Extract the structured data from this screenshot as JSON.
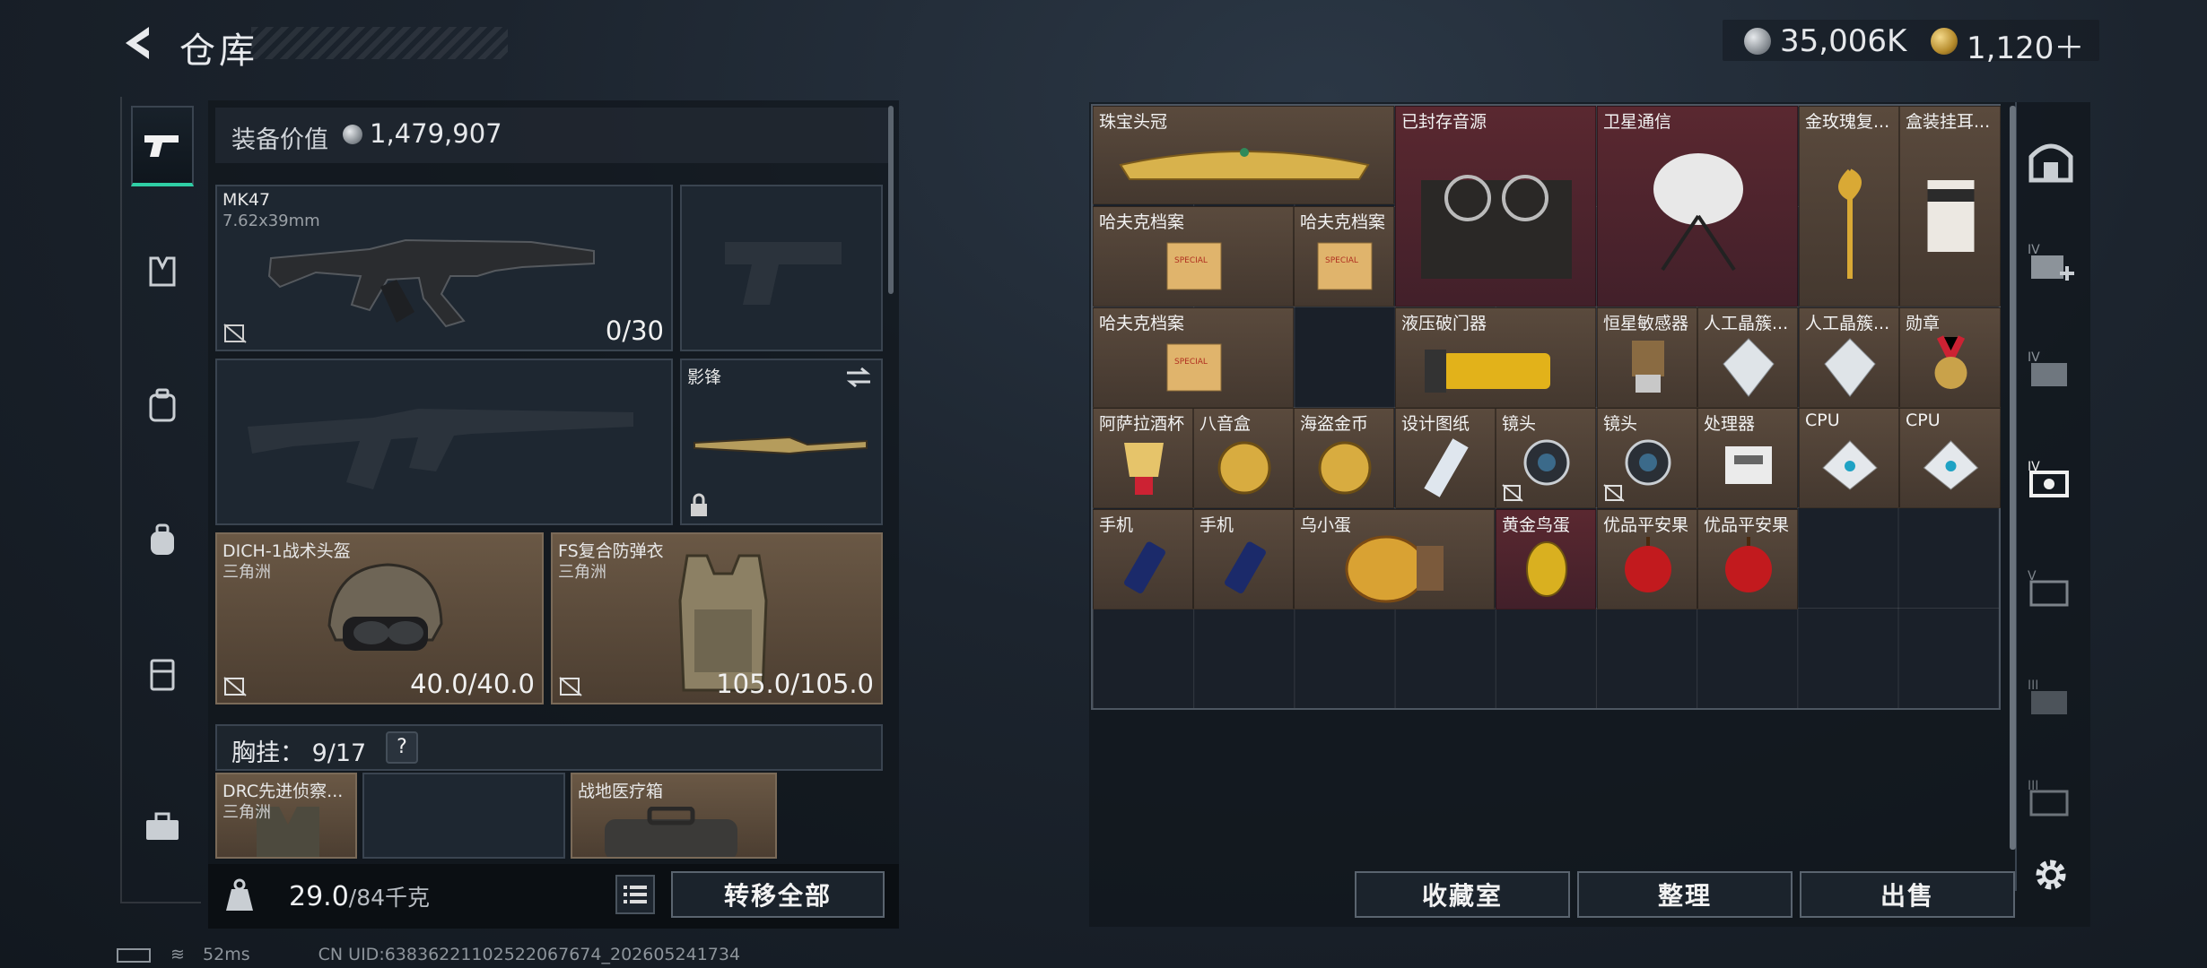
{
  "header": {
    "title": "仓库"
  },
  "currency": {
    "silver": "35,006K",
    "gold": "1,120＋"
  },
  "loadout": {
    "value_label": "装备价值",
    "value_amount": "1,479,907",
    "primary_weapon": {
      "name": "MK47",
      "caliber": "7.62x39mm",
      "ammo": "0/30"
    },
    "melee": {
      "name": "影锋"
    },
    "helmet": {
      "name": "DICH-1战术头盔",
      "origin": "三角洲",
      "durability": "40.0/40.0"
    },
    "armor": {
      "name": "FS复合防弹衣",
      "origin": "三角洲",
      "durability": "105.0/105.0"
    },
    "chest_rig": {
      "label": "胸挂：",
      "count": "9/17",
      "help": "?"
    },
    "chest_item": {
      "name": "DRC先进侦察...",
      "origin": "三角洲"
    },
    "medkit": {
      "name": "战地医疗箱"
    }
  },
  "weight": {
    "value": "29.0",
    "max": "/84千克"
  },
  "buttons": {
    "transfer_all": "转移全部",
    "collection": "收藏室",
    "sort": "整理",
    "sell": "出售"
  },
  "storage_items": [
    {
      "name": "珠宝头冠",
      "rarity": "tan"
    },
    {
      "name": "已封存音源",
      "rarity": "red"
    },
    {
      "name": "卫星通信",
      "rarity": "red"
    },
    {
      "name": "金玫瑰复...",
      "rarity": "tan"
    },
    {
      "name": "盒装挂耳...",
      "rarity": "tan"
    },
    {
      "name": "哈夫克档案",
      "rarity": "tan"
    },
    {
      "name": "哈夫克档案",
      "rarity": "tan"
    },
    {
      "name": "哈夫克档案",
      "rarity": "tan"
    },
    {
      "name": "液压破门器",
      "rarity": "tan"
    },
    {
      "name": "恒星敏感器",
      "rarity": "tan"
    },
    {
      "name": "人工晶簇...",
      "rarity": "tan"
    },
    {
      "name": "人工晶簇...",
      "rarity": "tan"
    },
    {
      "name": "勋章",
      "rarity": "tan"
    },
    {
      "name": "阿萨拉酒杯",
      "rarity": "tan"
    },
    {
      "name": "八音盒",
      "rarity": "tan"
    },
    {
      "name": "海盗金币",
      "rarity": "tan"
    },
    {
      "name": "设计图纸",
      "rarity": "tan"
    },
    {
      "name": "镜头",
      "rarity": "tan"
    },
    {
      "name": "镜头",
      "rarity": "tan"
    },
    {
      "name": "处理器",
      "rarity": "tan"
    },
    {
      "name": "CPU",
      "rarity": "tan"
    },
    {
      "name": "CPU",
      "rarity": "tan"
    },
    {
      "name": "手机",
      "rarity": "tan"
    },
    {
      "name": "手机",
      "rarity": "tan"
    },
    {
      "name": "乌小蛋",
      "rarity": "tan"
    },
    {
      "name": "黄金鸟蛋",
      "rarity": "red"
    },
    {
      "name": "优品平安果",
      "rarity": "tan"
    },
    {
      "name": "优品平安果",
      "rarity": "tan"
    }
  ],
  "status": {
    "ping": "52ms",
    "uid": "CN UID:6383622110252206767​4_202605241734"
  },
  "colors": {
    "accent": "#2fcfa5",
    "tan_rarity": "#5a4a3d",
    "red_rarity": "#5a2830"
  }
}
